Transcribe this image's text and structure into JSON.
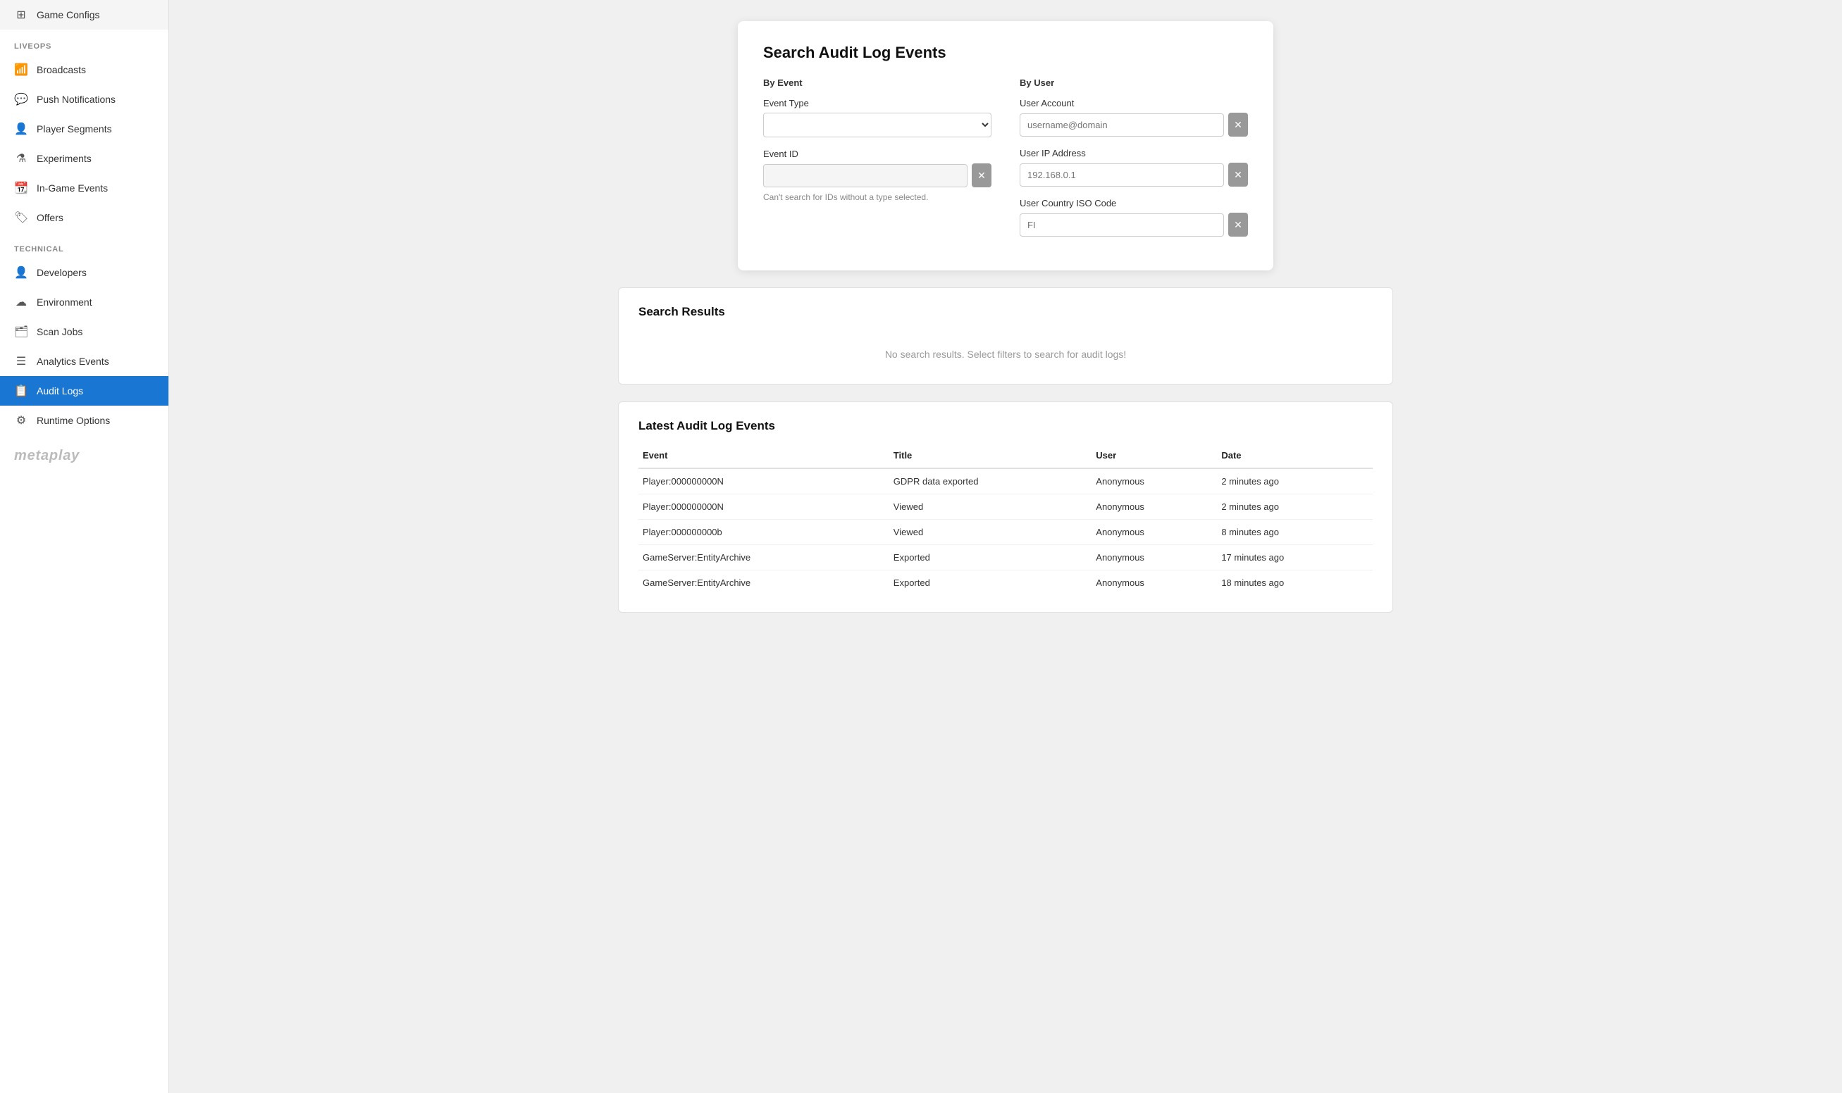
{
  "sidebar": {
    "sections": [
      {
        "label": "",
        "items": [
          {
            "id": "game-configs",
            "label": "Game Configs",
            "icon": "grid"
          }
        ]
      },
      {
        "label": "LiveOps",
        "items": [
          {
            "id": "broadcasts",
            "label": "Broadcasts",
            "icon": "broadcast"
          },
          {
            "id": "push-notifications",
            "label": "Push Notifications",
            "icon": "chat"
          },
          {
            "id": "player-segments",
            "label": "Player Segments",
            "icon": "person"
          },
          {
            "id": "experiments",
            "label": "Experiments",
            "icon": "flask"
          },
          {
            "id": "in-game-events",
            "label": "In-Game Events",
            "icon": "calendar"
          },
          {
            "id": "offers",
            "label": "Offers",
            "icon": "tag"
          }
        ]
      },
      {
        "label": "Technical",
        "items": [
          {
            "id": "developers",
            "label": "Developers",
            "icon": "person"
          },
          {
            "id": "environment",
            "label": "Environment",
            "icon": "cloud"
          },
          {
            "id": "scan-jobs",
            "label": "Scan Jobs",
            "icon": "briefcase"
          },
          {
            "id": "analytics-events",
            "label": "Analytics Events",
            "icon": "list"
          },
          {
            "id": "audit-logs",
            "label": "Audit Logs",
            "icon": "clipboard",
            "active": true
          },
          {
            "id": "runtime-options",
            "label": "Runtime Options",
            "icon": "settings"
          }
        ]
      }
    ],
    "logo": "metaplay"
  },
  "search": {
    "title": "Search Audit Log Events",
    "by_event_label": "By Event",
    "by_user_label": "By User",
    "event_type_label": "Event Type",
    "event_type_placeholder": "",
    "event_id_label": "Event ID",
    "event_id_value": "",
    "event_id_hint": "Can't search for IDs without a type selected.",
    "user_account_label": "User Account",
    "user_account_placeholder": "username@domain",
    "user_account_value": "",
    "user_ip_label": "User IP Address",
    "user_ip_placeholder": "192.168.0.1",
    "user_ip_value": "",
    "user_country_label": "User Country ISO Code",
    "user_country_placeholder": "FI",
    "user_country_value": ""
  },
  "search_results": {
    "title": "Search Results",
    "empty_message": "No search results. Select filters to search for audit logs!"
  },
  "audit_log": {
    "title": "Latest Audit Log Events",
    "columns": [
      "Event",
      "Title",
      "User",
      "Date"
    ],
    "rows": [
      {
        "event": "Player:000000000N",
        "title": "GDPR data exported",
        "user": "Anonymous",
        "date": "2 minutes ago"
      },
      {
        "event": "Player:000000000N",
        "title": "Viewed",
        "user": "Anonymous",
        "date": "2 minutes ago"
      },
      {
        "event": "Player:000000000b",
        "title": "Viewed",
        "user": "Anonymous",
        "date": "8 minutes ago"
      },
      {
        "event": "GameServer:EntityArchive",
        "title": "Exported",
        "user": "Anonymous",
        "date": "17 minutes ago"
      },
      {
        "event": "GameServer:EntityArchive",
        "title": "Exported",
        "user": "Anonymous",
        "date": "18 minutes ago"
      }
    ]
  }
}
